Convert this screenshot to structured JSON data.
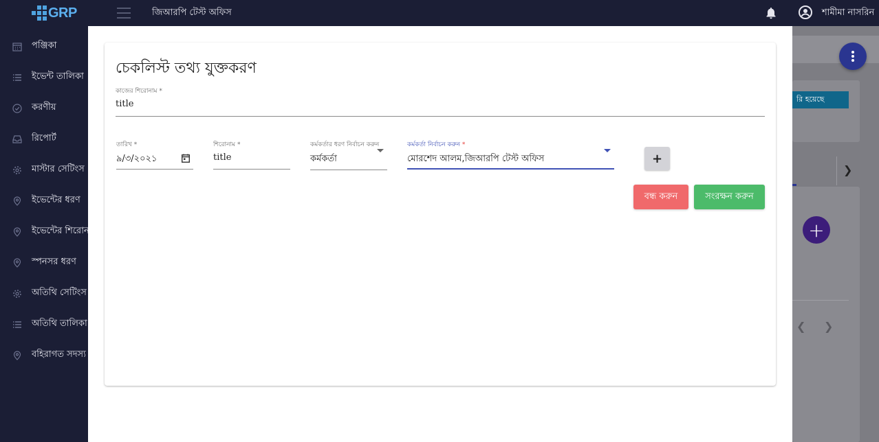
{
  "topbar": {
    "logo_text": "GRP",
    "office_title": "জিআরপি টেস্ট অফিস",
    "user_name": "শামীমা নাসরিন"
  },
  "sidebar": {
    "items": [
      {
        "label": "পঞ্জিকা",
        "icon": "calendar-icon"
      },
      {
        "label": "ইভেন্ট তালিকা",
        "icon": "list-icon"
      },
      {
        "label": "করণীয়",
        "icon": "check-circle-icon"
      },
      {
        "label": "রিপোর্ট",
        "icon": "inbox-icon"
      },
      {
        "label": "মাস্টার সেটিংস",
        "icon": "gear-icon"
      },
      {
        "label": "ইভেন্টের ধরণ",
        "icon": "map-pin-icon"
      },
      {
        "label": "ইভেন্টের শিরোনাম",
        "icon": "map-pin-icon"
      },
      {
        "label": "স্পনসর ধরণ",
        "icon": "map-pin-icon"
      },
      {
        "label": "অতিথি সেটিংস",
        "icon": "gear-icon"
      },
      {
        "label": "অতিথি তালিকা",
        "icon": "list-icon"
      },
      {
        "label": "বহিরাগত সদস্য",
        "icon": "map-pin-icon"
      }
    ]
  },
  "background": {
    "chip_text": "রি হয়েছে"
  },
  "modal": {
    "title": "চেকলিস্ট তথ্য যুক্তকরণ",
    "task_title": {
      "label": "কাজের শিরোনাম",
      "required": "*",
      "value": "title"
    },
    "date": {
      "label": "তারিখ",
      "required": "*",
      "value": "৯/৩/২০২১"
    },
    "heading": {
      "label": "শিরোনাম",
      "required": "*",
      "value": "title"
    },
    "officer_type": {
      "label": "কর্মকর্তার ধরণ নির্বাচন করুন",
      "value": "কর্মকর্তা"
    },
    "officer": {
      "label": "কর্মকর্তা নির্বাচন করুন",
      "required": "*",
      "value": "মোরশেদ আলম,জিআরপি টেস্ট অফিস"
    },
    "add_label": "+",
    "close_label": "বন্ধ করুন",
    "save_label": "সংরক্ষন করুন"
  },
  "colors": {
    "sidebar_bg": "#1b1e35",
    "accent": "#3f51b5",
    "close_button": "#f0696b",
    "save_button": "#4cbb6a"
  }
}
